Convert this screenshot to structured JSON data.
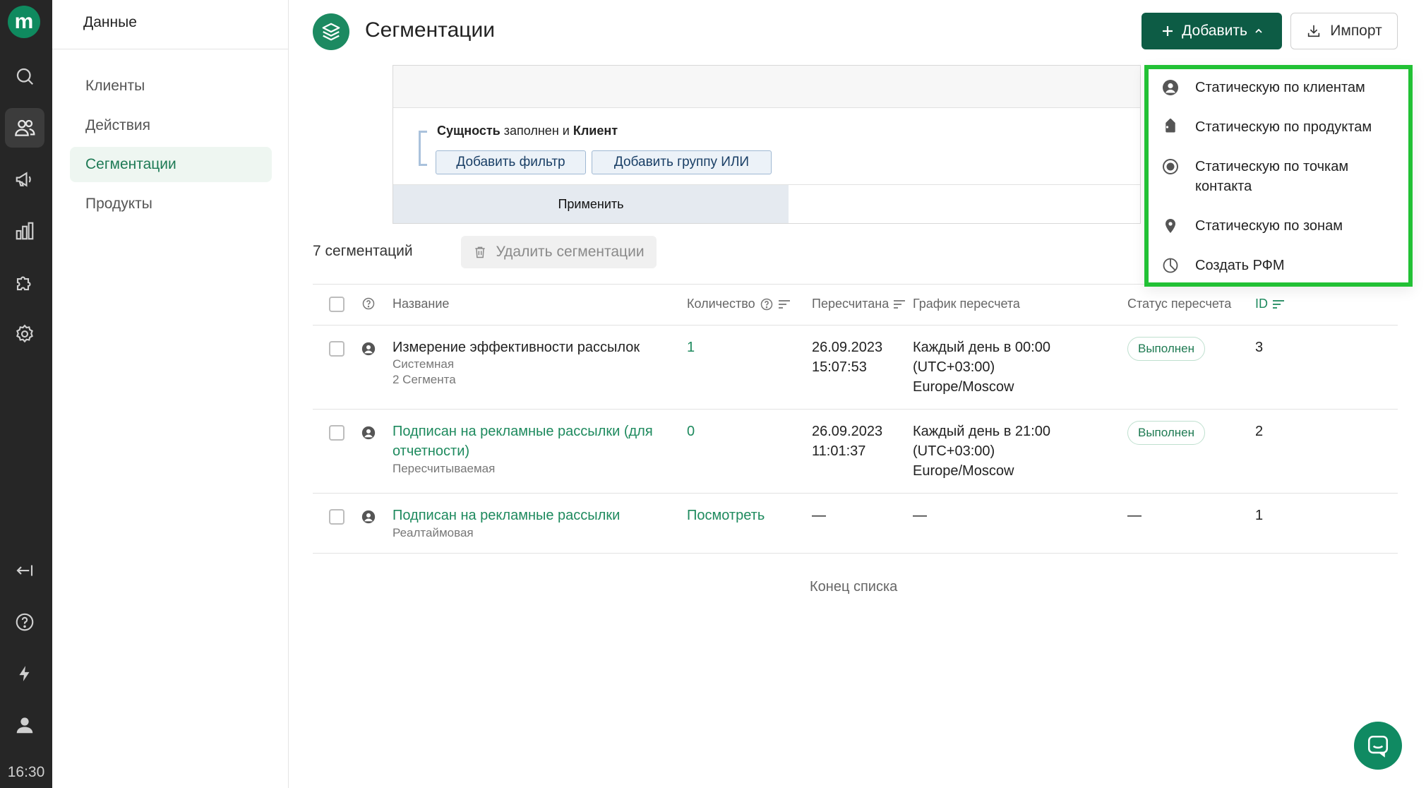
{
  "rail": {
    "logo": "m",
    "time": "16:30",
    "icons": [
      "search-icon",
      "users-icon",
      "megaphone-icon",
      "bar-chart-icon",
      "puzzle-icon",
      "gear-icon",
      "collapse-icon",
      "help-icon",
      "lightning-icon",
      "profile-icon"
    ]
  },
  "sidebar": {
    "title": "Данные",
    "items": [
      {
        "label": "Клиенты"
      },
      {
        "label": "Действия"
      },
      {
        "label": "Сегментации"
      },
      {
        "label": "Продукты"
      }
    ]
  },
  "page": {
    "title": "Сегментации",
    "add_label": "Добавить",
    "import_label": "Импорт"
  },
  "filter": {
    "cond_entity": "Сущность",
    "cond_filled": "заполнен",
    "cond_and": "и",
    "cond_client": "Клиент",
    "add_filter": "Добавить фильтр",
    "add_or_group": "Добавить группу ИЛИ",
    "apply": "Применить"
  },
  "list": {
    "count": "7 сегментаций",
    "delete_label": "Удалить сегментации",
    "end_text": "Конец списка"
  },
  "table": {
    "headers": {
      "name": "Название",
      "quantity": "Количество",
      "recalculated": "Пересчитана",
      "schedule": "График пересчета",
      "status": "Статус пересчета",
      "id": "ID"
    },
    "rows": [
      {
        "name": "Измерение эффективности рассылок",
        "sub1": "Системная",
        "sub2": "2 Сегмента",
        "quantity": "1",
        "date": "26.09.2023",
        "time": "15:07:53",
        "schedule1": "Каждый день в 00:00",
        "schedule2": "(UTC+03:00)",
        "schedule3": "Europe/Moscow",
        "status": "Выполнен",
        "id": "3"
      },
      {
        "name1": "Подписан на рекламные рассылки (для",
        "name2": "отчетности)",
        "sub1": "Пересчитываемая",
        "quantity": "0",
        "date": "26.09.2023",
        "time": "11:01:37",
        "schedule1": "Каждый день в 21:00",
        "schedule2": "(UTC+03:00)",
        "schedule3": "Europe/Moscow",
        "status": "Выполнен",
        "id": "2"
      },
      {
        "name": "Подписан на рекламные рассылки",
        "sub1": "Реалтаймовая",
        "quantity": "Посмотреть",
        "date": "—",
        "schedule": "—",
        "status": "—",
        "id": "1"
      }
    ]
  },
  "dropdown": {
    "items": [
      {
        "label": "Статическую по клиентам",
        "icon": "user-circle-icon"
      },
      {
        "label": "Статическую по продуктам",
        "icon": "tag-icon"
      },
      {
        "label1": "Статическую по точкам",
        "label2": "контакта",
        "icon": "radio-target-icon"
      },
      {
        "label": "Статическую по зонам",
        "icon": "map-pin-icon"
      },
      {
        "label": "Создать РФМ",
        "icon": "pie-chart-icon"
      }
    ]
  },
  "colors": {
    "brand": "#0f8a5f",
    "add_button": "#0d5c45",
    "highlight_border": "#22c135",
    "rail_bg": "#262626"
  }
}
